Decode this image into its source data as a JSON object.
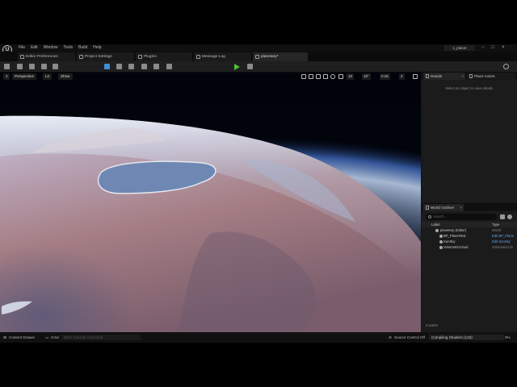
{
  "menubar": {
    "items": [
      "File",
      "Edit",
      "Window",
      "Tools",
      "Build",
      "Help"
    ],
    "project_name": "s_planet"
  },
  "tabs": [
    {
      "label": "Editor Preferences"
    },
    {
      "label": "Project Settings"
    },
    {
      "label": "Plugins"
    },
    {
      "label": "Message Log"
    },
    {
      "label": "planetary*"
    }
  ],
  "viewport": {
    "perspective_label": "Perspective",
    "lit_label": "Lit",
    "show_label": "Show",
    "grid_snap": "10",
    "rotation_snap": "10°",
    "scale_snap": "0.25",
    "camera_speed": "4"
  },
  "details": {
    "tab_label": "Details",
    "empty_message": "Select an object to view details."
  },
  "place_actors": {
    "tab_label": "Place Actors"
  },
  "outliner": {
    "tab_label": "World Outliner",
    "search_placeholder": "Search...",
    "col_label": "Label",
    "col_type": "Type",
    "rows": [
      {
        "label": "planetary (Editor)",
        "type": "World"
      },
      {
        "label": "BP_PlanetTest",
        "type": "Edit BP_Plane"
      },
      {
        "label": "SunSky",
        "type": "Edit SunSky"
      },
      {
        "label": "VolumetricCloud",
        "type": "VolumetricClo"
      }
    ],
    "actor_count": "3 actors"
  },
  "statusbar": {
    "content_drawer": "Content Drawer",
    "cmd_label": "Cmd",
    "cmd_placeholder": "Enter Console Command",
    "source_control": "Source Control Off",
    "compiling": "Compiling Shaders (133)",
    "percent": "0%"
  },
  "colors": {
    "accent_blue": "#3c8fd4",
    "play_green": "#4fbf3a",
    "link_blue": "#5fa8e8"
  }
}
